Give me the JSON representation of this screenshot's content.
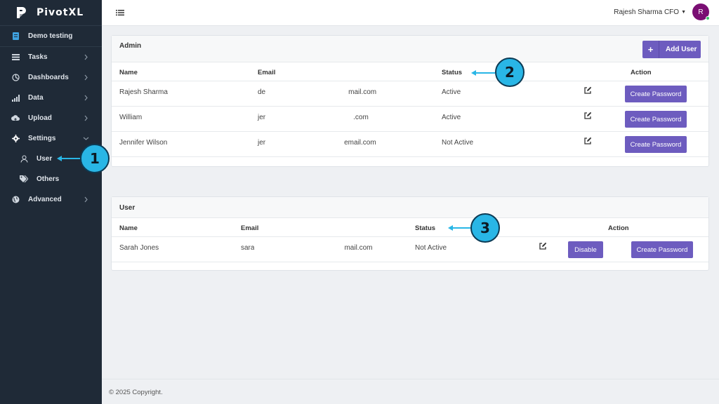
{
  "brand": {
    "name": "PivotXL"
  },
  "sidebar": {
    "items": [
      {
        "label": "Demo testing",
        "icon": "document-icon"
      },
      {
        "label": "Tasks",
        "icon": "tasks-icon"
      },
      {
        "label": "Dashboards",
        "icon": "dashboard-icon"
      },
      {
        "label": "Data",
        "icon": "bar-chart-icon"
      },
      {
        "label": "Upload",
        "icon": "cloud-upload-icon"
      },
      {
        "label": "Settings",
        "icon": "gear-icon"
      },
      {
        "label": "User",
        "icon": "user-icon"
      },
      {
        "label": "Others",
        "icon": "tags-icon"
      },
      {
        "label": "Advanced",
        "icon": "globe-icon"
      }
    ]
  },
  "topbar": {
    "user_label": "Rajesh Sharma CFO",
    "avatar_initial": "R"
  },
  "admin_card": {
    "title": "Admin",
    "add_button": "Add User",
    "columns": {
      "name": "Name",
      "email": "Email",
      "status": "Status",
      "action": "Action"
    },
    "rows": [
      {
        "name": "Rajesh Sharma",
        "email_start": "de",
        "email_end": "mail.com",
        "status": "Active",
        "action": "Create Password"
      },
      {
        "name": "William",
        "email_start": "jer",
        "email_end": ".com",
        "status": "Active",
        "action": "Create Password"
      },
      {
        "name": "Jennifer Wilson",
        "email_start": "jer",
        "email_end": "email.com",
        "status": "Not Active",
        "action": "Create Password"
      }
    ]
  },
  "user_card": {
    "title": "User",
    "columns": {
      "name": "Name",
      "email": "Email",
      "status": "Status",
      "action": "Action"
    },
    "rows": [
      {
        "name": "Sarah Jones",
        "email_start": "sara",
        "email_end": "mail.com",
        "status": "Not Active",
        "disable": "Disable",
        "action": "Create Password"
      }
    ]
  },
  "callouts": [
    "1",
    "2",
    "3"
  ],
  "footer": {
    "copyright": "© 2025 Copyright."
  },
  "colors": {
    "sidebar": "#1f2a37",
    "accent": "#6d5cbf",
    "callout": "#29b6e6",
    "avatar": "#7a0e73"
  }
}
